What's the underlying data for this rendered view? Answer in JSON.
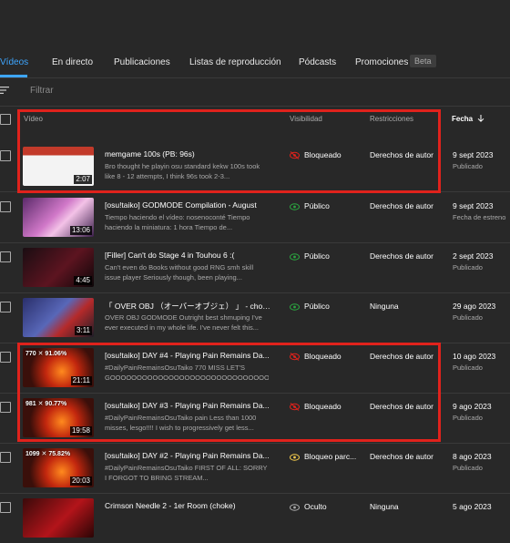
{
  "tabs": [
    {
      "label": "Vídeos",
      "active": true
    },
    {
      "label": "En directo"
    },
    {
      "label": "Publicaciones"
    },
    {
      "label": "Listas de reproducción"
    },
    {
      "label": "Pódcasts"
    },
    {
      "label": "Promociones"
    }
  ],
  "tab_badge": "Beta",
  "filter": {
    "placeholder": "Filtrar",
    "icon": "filter-icon"
  },
  "columns": {
    "video": "Vídeo",
    "visibility": "Visibilidad",
    "restrictions": "Restricciones",
    "date": "Fecha",
    "date_sort_icon": "arrow-down-icon"
  },
  "rows": [
    {
      "title": "memgame 100s (PB: 96s)",
      "description": "Bro thought he playin osu standard kekw 100s took like 8 - 12 attempts, I think 96s took 2-3...",
      "duration": "2:07",
      "visibility": "Bloqueado",
      "visibility_icon": "blocked-eye-icon",
      "restrictions": "Derechos de autor",
      "date": "9 sept 2023",
      "status": "Publicado"
    },
    {
      "title": "[osu!taiko] GODMODE Compilation - August",
      "description": "Tiempo haciendo el vídeo: nosenoconté Tiempo haciendo la miniatura: 1 hora Tiempo de...",
      "duration": "13:06",
      "visibility": "Público",
      "visibility_icon": "eye-icon",
      "restrictions": "Derechos de autor",
      "date": "9 sept 2023",
      "status": "Fecha de estreno"
    },
    {
      "title": "[Filler] Can't do Stage 4 in Touhou 6 :(",
      "description": "Can't even do Books without good RNG smh skill issue player Seriously though, been playing...",
      "duration": "4:45",
      "visibility": "Público",
      "visibility_icon": "eye-icon",
      "restrictions": "Derechos de autor",
      "date": "2 sept 2023",
      "status": "Publicado"
    },
    {
      "title": "「 OVER OBJ （オーバーオブジェ） 」 - choke...",
      "description": "OVER OBJ GODMODE Outright best shmuping I've ever executed in my whole life. I've never felt this...",
      "duration": "3:11",
      "visibility": "Público",
      "visibility_icon": "eye-icon",
      "restrictions": "Ninguna",
      "date": "29 ago 2023",
      "status": "Publicado"
    },
    {
      "title": "[osu!taiko] DAY #4 - Playing Pain Remains Da...",
      "description": "#DailyPainRemainsOsuTaiko 770 MISS LET'S GOOOOOOOOOOOOOOOOOOOOOOOOOOOOOOOOOO...",
      "duration": "21:11",
      "thumb_text": "770 ✕   91.06%",
      "visibility": "Bloqueado",
      "visibility_icon": "blocked-eye-icon",
      "restrictions": "Derechos de autor",
      "date": "10 ago 2023",
      "status": "Publicado"
    },
    {
      "title": "[osu!taiko] DAY #3 - Playing Pain Remains Da...",
      "description": "#DailyPainRemainsOsuTaiko pain Less than 1000 misses, lesgo!!!! I wish to progressively get less...",
      "duration": "19:58",
      "thumb_text": "981 ✕   90.77%",
      "visibility": "Bloqueado",
      "visibility_icon": "blocked-eye-icon",
      "restrictions": "Derechos de autor",
      "date": "9 ago 2023",
      "status": "Publicado"
    },
    {
      "title": "[osu!taiko] DAY #2 - Playing Pain Remains Da...",
      "description": "#DailyPainRemainsOsuTaiko FIRST OF ALL: SORRY I FORGOT TO BRING STREAM...",
      "duration": "20:03",
      "thumb_text": "1099 ✕   75.82%",
      "visibility": "Bloqueo parc...",
      "visibility_icon": "partial-block-icon",
      "restrictions": "Derechos de autor",
      "date": "8 ago 2023",
      "status": "Publicado"
    },
    {
      "title": "Crimson Needle 2 - 1er Room (choke)",
      "description": "",
      "duration": "",
      "visibility": "Oculto",
      "visibility_icon": "hidden-icon",
      "restrictions": "Ninguna",
      "date": "5 ago 2023",
      "status": ""
    }
  ],
  "colors": {
    "background": "#282828",
    "accent": "#3ea6ff",
    "highlight": "#e0221c",
    "public": "#2ba640",
    "partial": "#f2c94c"
  }
}
